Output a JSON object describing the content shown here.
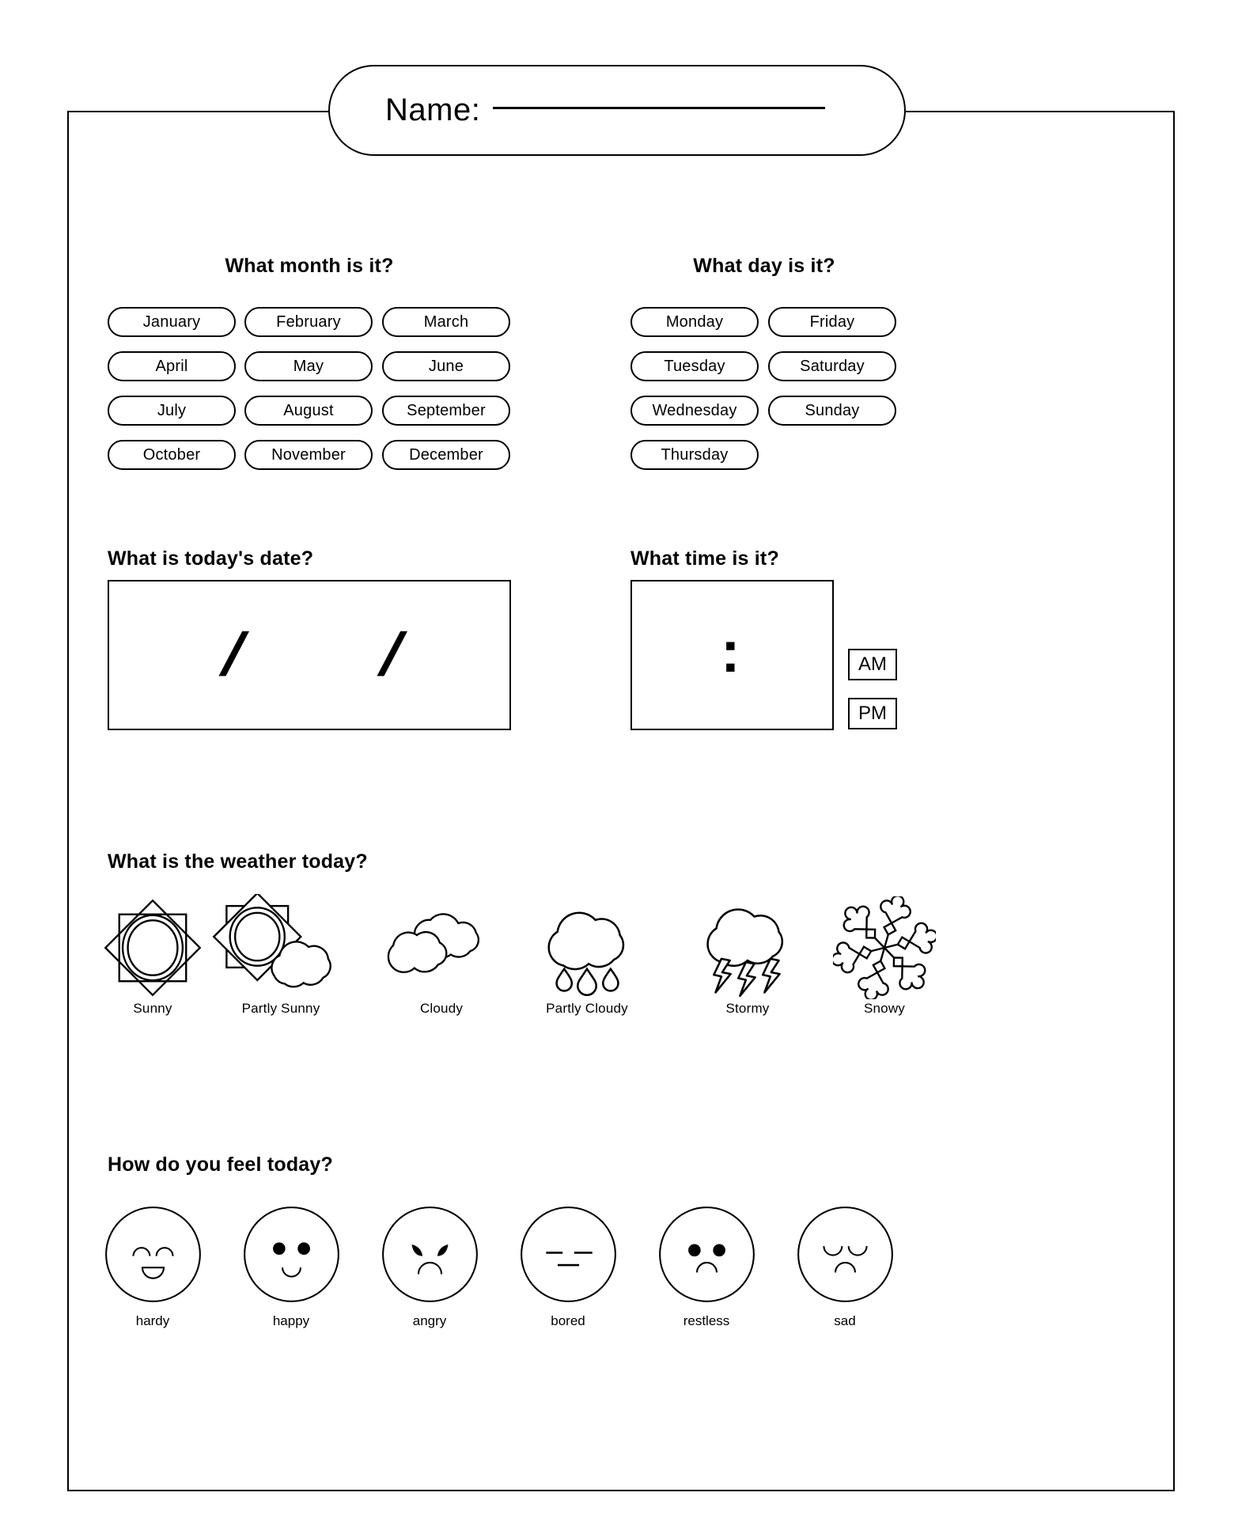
{
  "worksheet": {
    "name_field": {
      "label": "Name:",
      "value": ""
    }
  },
  "month_section": {
    "heading": "What month is it?",
    "options": [
      "January",
      "February",
      "March",
      "April",
      "May",
      "June",
      "July",
      "August",
      "September",
      "October",
      "November",
      "December"
    ]
  },
  "day_section": {
    "heading": "What day is it?",
    "options": [
      "Monday",
      "Friday",
      "Tuesday",
      "Saturday",
      "Wednesday",
      "Sunday",
      "Thursday"
    ]
  },
  "date_section": {
    "heading": "What is today's date?",
    "separator_1": "/",
    "separator_2": "/",
    "value": ""
  },
  "time_section": {
    "heading": "What time is it?",
    "separator": ":",
    "value": "",
    "am_label": "AM",
    "pm_label": "PM"
  },
  "weather_section": {
    "heading": "What is the weather today?",
    "options": [
      {
        "label": "Sunny",
        "icon": "sun-icon"
      },
      {
        "label": "Partly Sunny",
        "icon": "sun-behind-cloud-icon"
      },
      {
        "label": "Cloudy",
        "icon": "clouds-icon"
      },
      {
        "label": "Partly Cloudy",
        "icon": "rain-cloud-icon"
      },
      {
        "label": "Stormy",
        "icon": "storm-cloud-icon"
      },
      {
        "label": "Snowy",
        "icon": "snowflake-icon"
      }
    ]
  },
  "feeling_section": {
    "heading": "How do you feel today?",
    "options": [
      {
        "label": "hardy",
        "icon": "face-hardy-icon"
      },
      {
        "label": "happy",
        "icon": "face-happy-icon"
      },
      {
        "label": "angry",
        "icon": "face-angry-icon"
      },
      {
        "label": "bored",
        "icon": "face-bored-icon"
      },
      {
        "label": "restless",
        "icon": "face-restless-icon"
      },
      {
        "label": "sad",
        "icon": "face-sad-icon"
      }
    ]
  },
  "colors": {
    "ink": "#000000",
    "paper": "#ffffff"
  }
}
